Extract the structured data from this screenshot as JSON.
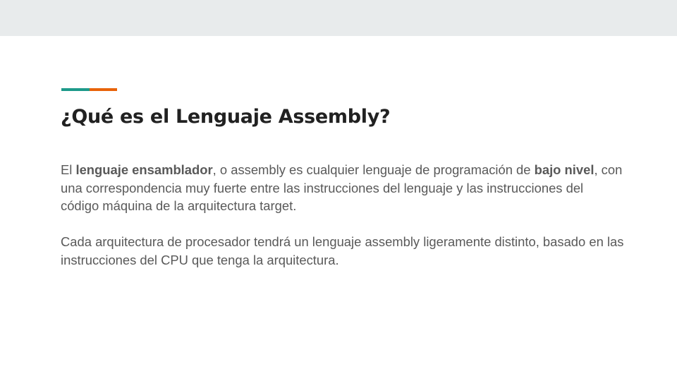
{
  "slide": {
    "title": "¿Qué es el Lenguaje Assembly?",
    "accent_colors": {
      "left": "#1d9a8a",
      "right": "#e8630a"
    },
    "paragraph1": {
      "t1": "El ",
      "b1": "lenguaje ensamblador",
      "t2": ", o assembly es cualquier lenguaje de programación de ",
      "b2": "bajo nivel",
      "t3": ", con una correspondencia muy fuerte entre las instrucciones del lenguaje y las instrucciones del código máquina de la arquitectura target."
    },
    "paragraph2": "Cada arquitectura de procesador tendrá un lenguaje assembly ligeramente distinto, basado en las instrucciones del CPU que tenga la arquitectura."
  }
}
